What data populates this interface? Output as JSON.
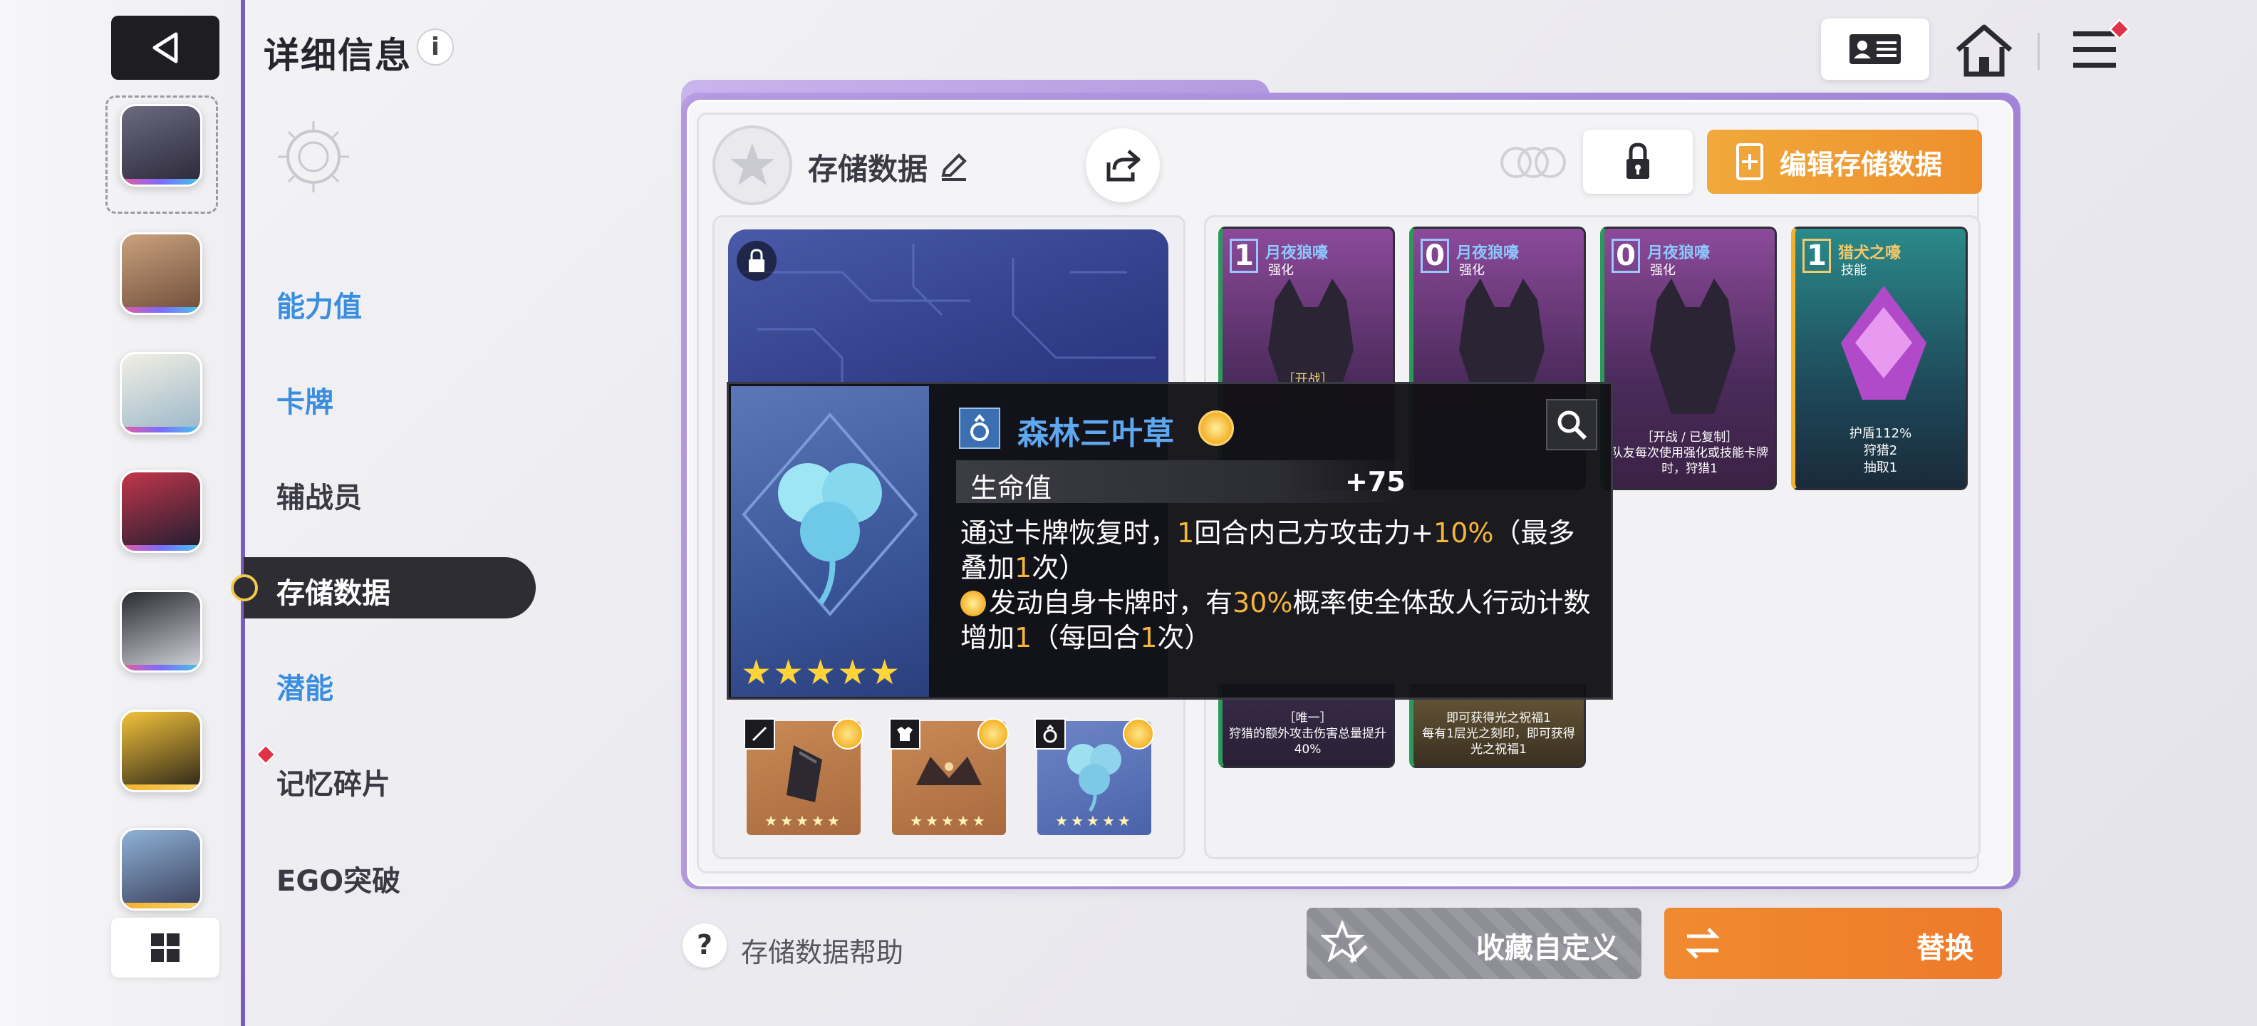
{
  "header": {
    "title": "详细信息",
    "info_glyph": "i"
  },
  "nav": {
    "items": [
      {
        "label": "能力值"
      },
      {
        "label": "卡牌"
      },
      {
        "label": "辅战员"
      },
      {
        "label": "存储数据"
      },
      {
        "label": "潜能"
      },
      {
        "label": "记忆碎片"
      },
      {
        "label": "EGO突破"
      }
    ]
  },
  "slot": {
    "name": "存储数据"
  },
  "actions": {
    "edit_label": "编辑存储数据"
  },
  "tooltip": {
    "name": "森林三叶草",
    "stars": "★★★★★",
    "stat_label": "生命值",
    "stat_value": "+75",
    "d1a": "通过卡牌恢复时，",
    "d1b": "1",
    "d1c": "回合内己方攻击力+",
    "d1d": "10%",
    "d1e": "（最多叠加",
    "d1f": "1",
    "d1g": "次）",
    "d2a": "发动自身卡牌时，有",
    "d2b": "30%",
    "d2c": "概率使全体敌人行动计数增加",
    "d2d": "1",
    "d2e": "（每回合",
    "d2f": "1",
    "d2g": "次）"
  },
  "cards": [
    {
      "cost": "1",
      "name": "月夜狼嚎",
      "type": "强化",
      "desc": "［开战］"
    },
    {
      "cost": "0",
      "name": "月夜狼嚎",
      "type": "强化",
      "desc": ""
    },
    {
      "cost": "0",
      "name": "月夜狼嚎",
      "type": "强化",
      "desc": "［开战 / 已复制］\n队友每次使用强化或技能卡牌时，狩猎1"
    },
    {
      "cost": "1",
      "name": "猎犬之嚎",
      "type": "技能",
      "desc": "护盾112%\n狩猎2\n抽取1"
    }
  ],
  "cards_lower": [
    {
      "desc": "［唯一］\n狩猎的额外攻击伤害总量提升40%"
    },
    {
      "desc": "即可获得光之祝福1\n每有1层光之刻印，即可获得光之祝福1"
    }
  ],
  "equipment": [
    {
      "stars": "★★★★★"
    },
    {
      "stars": "★★★★★"
    },
    {
      "stars": "★★★★★"
    }
  ],
  "bottom": {
    "help_glyph": "?",
    "help_label": "存储数据帮助",
    "fav_label": "收藏自定义",
    "swap_label": "替换"
  },
  "colors": {
    "accent_purple": "#7c5bbd",
    "orange": "#ee8f2e",
    "highlight": "#f5b43a",
    "blue_label": "#3a8ee0"
  }
}
